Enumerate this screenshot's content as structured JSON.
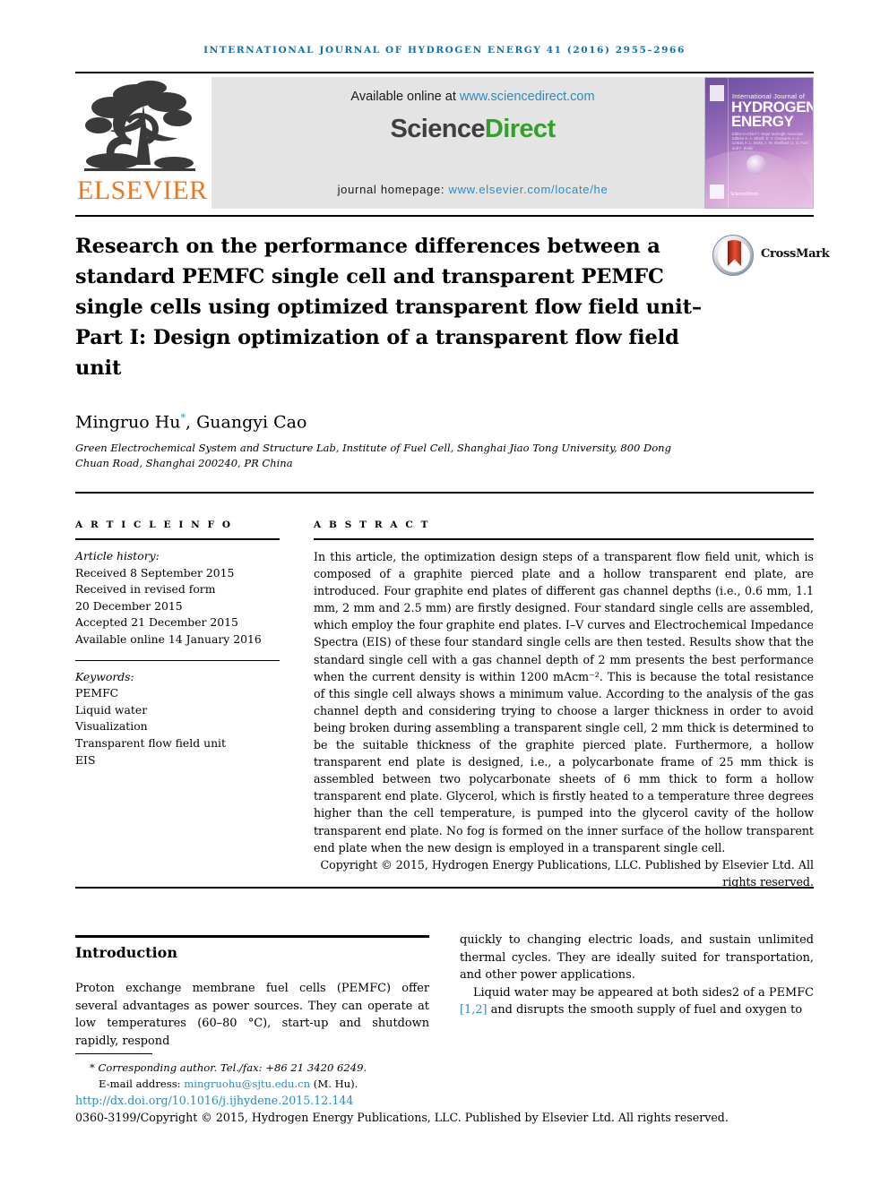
{
  "running_head": "INTERNATIONAL JOURNAL OF HYDROGEN ENERGY 41 (2016) 2955–2966",
  "masthead": {
    "publisher_name": "ELSEVIER",
    "available_prefix": "Available online at ",
    "available_url": "www.sciencedirect.com",
    "logo_part1": "Science",
    "logo_part2": "Direct",
    "homepage_prefix": "journal homepage: ",
    "homepage_url": "www.elsevier.com/locate/he",
    "cover": {
      "line1": "International Journal of",
      "line2": "HYDROGEN",
      "line3": "ENERGY",
      "editors": "Editor-in-Chief  T. Nejat Veziroğlu\nAssociate Editors  S. A. Sherif, D. Y. Goswami, A. A. Linkov,\nA. L. Dicks, J. W. Sheffield,\nG. G. Fuel  and  F. Barbir",
      "sciencedirect": "ScienceDirect"
    }
  },
  "article": {
    "title": "Research on the performance differences between a standard PEMFC single cell and transparent PEMFC single cells using optimized transparent flow field unit–Part I: Design optimization of a transparent flow field unit",
    "crossmark_label": "CrossMark",
    "authors": "Mingruo Hu",
    "author_marker": "*",
    "authors_rest": ", Guangyi Cao",
    "affiliation": "Green Electrochemical System and Structure Lab, Institute of Fuel Cell, Shanghai Jiao Tong University, 800 Dong Chuan Road, Shanghai 200240, PR China"
  },
  "article_info": {
    "heading": "A R T I C L E  I N F O",
    "history_label": "Article history:",
    "history": [
      "Received 8 September 2015",
      "Received in revised form",
      "20 December 2015",
      "Accepted 21 December 2015",
      "Available online 14 January 2016"
    ],
    "keywords_label": "Keywords:",
    "keywords": [
      "PEMFC",
      "Liquid water",
      "Visualization",
      "Transparent flow field unit",
      "EIS"
    ]
  },
  "abstract": {
    "heading": "A B S T R A C T",
    "body": "In this article, the optimization design steps of a transparent flow field unit, which is composed of a graphite pierced plate and a hollow transparent end plate, are introduced. Four graphite end plates of different gas channel depths (i.e., 0.6 mm, 1.1 mm, 2 mm and 2.5 mm) are firstly designed. Four standard single cells are assembled, which employ the four graphite end plates. I–V curves and Electrochemical Impedance Spectra (EIS) of these four standard single cells are then tested. Results show that the standard single cell with a gas channel depth of 2 mm presents the best performance when the current density is within 1200 mAcm⁻². This is because the total resistance of this single cell always shows a minimum value. According to the analysis of the gas channel depth and considering trying to choose a larger thickness in order to avoid being broken during assembling a transparent single cell, 2 mm thick is determined to be the suitable thickness of the graphite pierced plate. Furthermore, a hollow transparent end plate is designed, i.e., a polycarbonate frame of 25 mm thick is assembled between two polycarbonate sheets of 6 mm thick to form a hollow transparent end plate. Glycerol, which is firstly heated to a temperature three degrees higher than the cell temperature, is pumped into the glycerol cavity of the hollow transparent end plate. No fog is formed on the inner surface of the hollow transparent end plate when the new design is employed in a transparent single cell.",
    "copyright": "Copyright © 2015, Hydrogen Energy Publications, LLC. Published by Elsevier Ltd. All rights reserved."
  },
  "introduction": {
    "heading": "Introduction",
    "paragraph1": "Proton exchange membrane fuel cells (PEMFC) offer several advantages as power sources. They can operate at low temperatures (60–80 °C), start-up and shutdown rapidly, respond",
    "paragraph1_cont": "quickly to changing electric loads, and sustain unlimited thermal cycles. They are ideally suited for transportation, and other power applications.",
    "paragraph2_pre": "Liquid water may be appeared at both sides2 of a PEMFC ",
    "paragraph2_ref": "[1,2]",
    "paragraph2_post": " and disrupts the smooth supply of fuel and oxygen to"
  },
  "footer": {
    "corresponding_marker": "*",
    "corresponding": "Corresponding author. Tel./fax: +86 21 3420 6249.",
    "email_label": "E-mail address: ",
    "email": "mingruohu@sjtu.edu.cn",
    "email_suffix": " (M. Hu).",
    "doi": "http://dx.doi.org/10.1016/j.ijhydene.2015.12.144",
    "issn_line": "0360-3199/Copyright © 2015, Hydrogen Energy Publications, LLC. Published by Elsevier Ltd. All rights reserved."
  },
  "colors": {
    "link": "#2b8cbe",
    "running_head": "#1271a8",
    "elsevier_orange": "#e87722",
    "sciencedirect_green": "#33a02c",
    "banner_gray": "#e4e4e4"
  }
}
